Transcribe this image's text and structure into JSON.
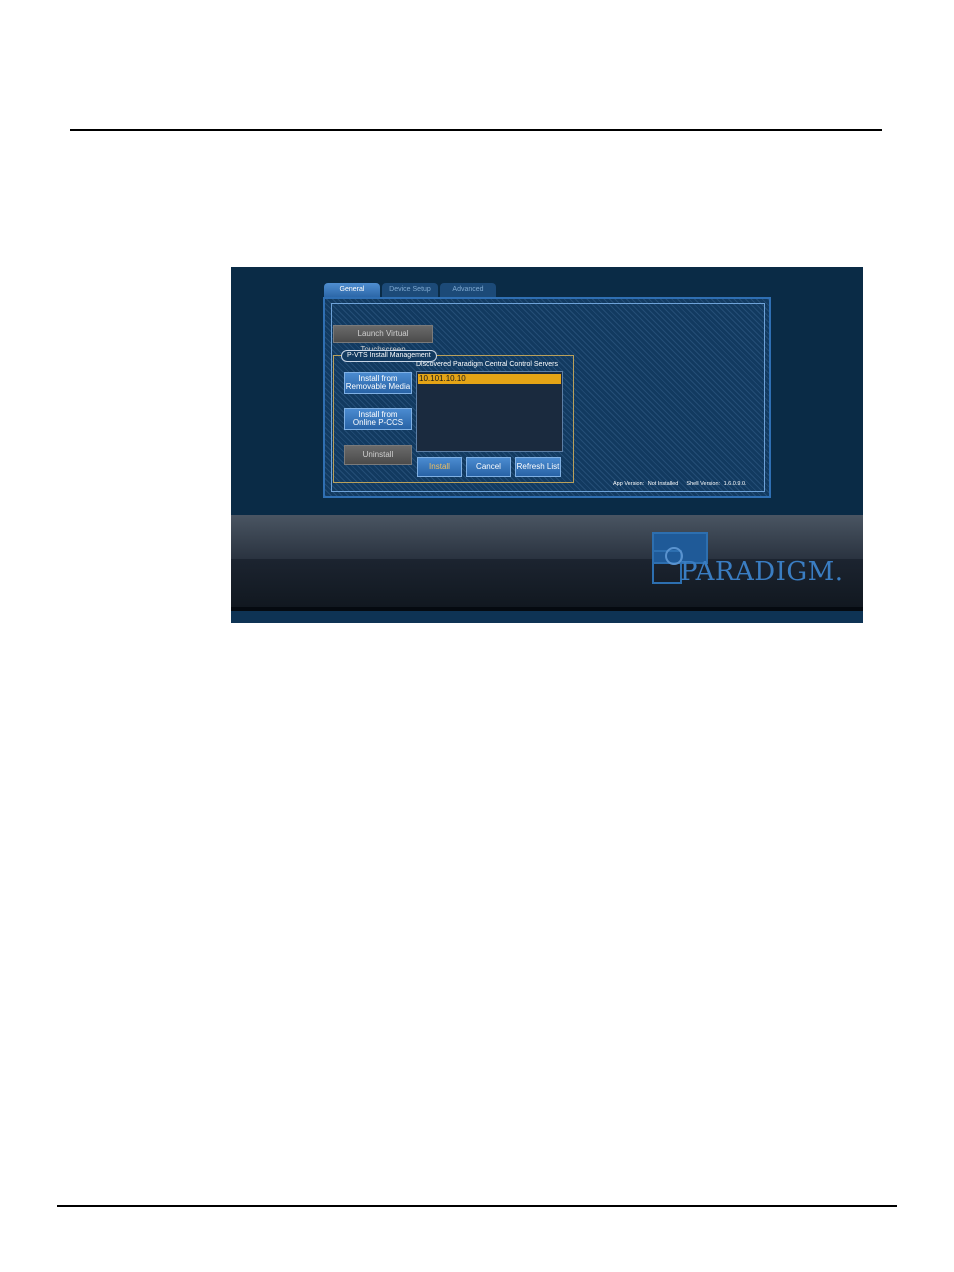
{
  "screenshot": {
    "tabs": [
      {
        "label": "General",
        "active": true
      },
      {
        "label": "Device Setup",
        "active": false
      },
      {
        "label": "Advanced",
        "active": false
      }
    ],
    "launch_button": "Launch Virtual Touchscreen",
    "install_group": {
      "title": "P-VTS Install Management",
      "install_removable": [
        "Install from",
        "Removable Media"
      ],
      "install_online": [
        "Install from",
        "Online P-CCS"
      ],
      "uninstall": "Uninstall",
      "servers_title": "Discovered Paradigm Central Control Servers",
      "servers": [
        "10.101.10.10"
      ],
      "install_button": "Install",
      "cancel_button": "Cancel",
      "refresh_button": "Refresh List"
    },
    "version": {
      "app_label": "App Version:",
      "app_value": "Not Installed",
      "shell_label": "Shell Version:",
      "shell_value": "1.6.0.9.0."
    },
    "logo_text": "PARADIGM."
  },
  "colors": {
    "accent_blue": "#2c67a8",
    "selection_gold": "#e4a416",
    "background_navy": "#0a2b46"
  }
}
